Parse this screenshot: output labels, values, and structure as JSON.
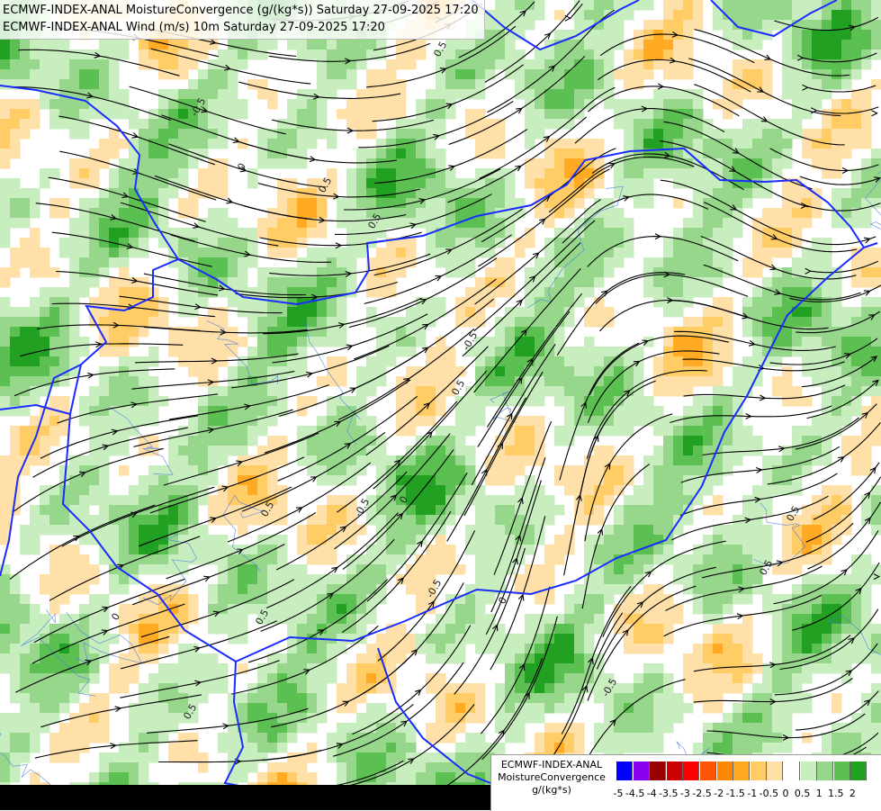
{
  "header": {
    "line1": "ECMWF-INDEX-ANAL MoistureConvergence (g/(kg*s)) Saturday 27-09-2025 17:20",
    "line2": "ECMWF-INDEX-ANAL Wind (m/s) 10m Saturday 27-09-2025 17:20"
  },
  "legend": {
    "line1": "ECMWF-INDEX-ANAL",
    "line2": "MoistureConvergence",
    "line3": "g/(kg*s)",
    "ticks": [
      "-5",
      "-4.5",
      "-4",
      "-3.5",
      "-3",
      "-2.5",
      "-2",
      "-1.5",
      "-1",
      "-0.5",
      "0",
      "0.5",
      "1",
      "1.5",
      "2"
    ],
    "colors": [
      "#0000ff",
      "#8800ee",
      "#990000",
      "#cc0000",
      "#ff0000",
      "#ff5500",
      "#ff8800",
      "#ffaa22",
      "#ffcc66",
      "#ffe0a8",
      "#ffffff",
      "#c8eec0",
      "#96d78c",
      "#5cbf52",
      "#22a022"
    ]
  },
  "map": {
    "contour_labels": [
      "0.5",
      "-0.5",
      "0",
      "0.5",
      "0.5",
      "-0.5",
      "0.5",
      "0",
      "-0.5",
      "0.5",
      "0.5",
      "-0.5",
      "0",
      "0.5",
      "0.5",
      "0",
      "-0.5",
      "0.5"
    ]
  }
}
